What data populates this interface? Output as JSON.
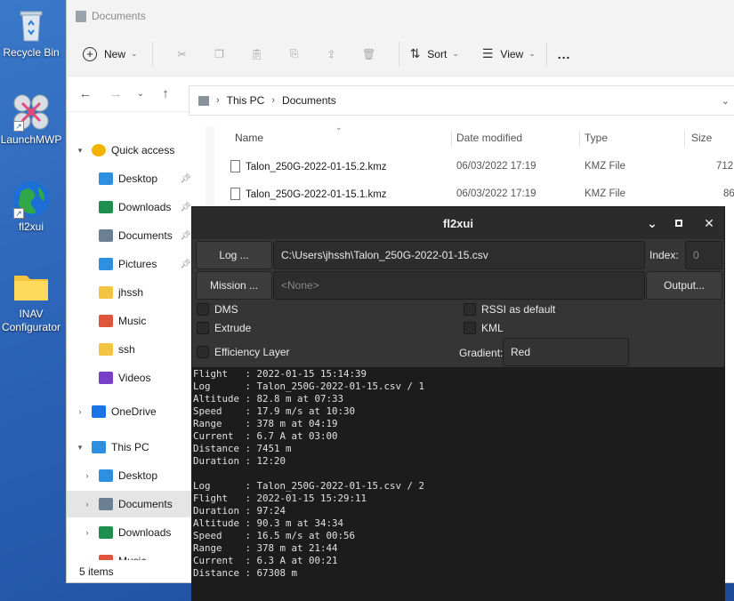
{
  "desktop": {
    "icons": [
      {
        "label": "Recycle Bin"
      },
      {
        "label": "LaunchMWP"
      },
      {
        "label": "fl2xui"
      },
      {
        "label": "INAV\nConfigurator"
      }
    ]
  },
  "explorer": {
    "title": "Documents",
    "toolbar": {
      "new_label": "New",
      "sort_label": "Sort",
      "view_label": "View",
      "more_label": "..."
    },
    "address": {
      "root": "This PC",
      "current": "Documents"
    },
    "sidebar": [
      {
        "label": "Quick access",
        "indent": 0,
        "expander": "▾",
        "icon": "star-icon",
        "pinned": false,
        "selected": false
      },
      {
        "label": "Desktop",
        "indent": 1,
        "expander": "",
        "icon": "desktop-icon",
        "pinned": true,
        "selected": false
      },
      {
        "label": "Downloads",
        "indent": 1,
        "expander": "",
        "icon": "download-icon",
        "pinned": true,
        "selected": false
      },
      {
        "label": "Documents",
        "indent": 1,
        "expander": "",
        "icon": "document-icon",
        "pinned": true,
        "selected": false
      },
      {
        "label": "Pictures",
        "indent": 1,
        "expander": "",
        "icon": "picture-icon",
        "pinned": true,
        "selected": false
      },
      {
        "label": "jhssh",
        "indent": 1,
        "expander": "",
        "icon": "folder-icon",
        "pinned": false,
        "selected": false
      },
      {
        "label": "Music",
        "indent": 1,
        "expander": "",
        "icon": "music-icon",
        "pinned": false,
        "selected": false
      },
      {
        "label": "ssh",
        "indent": 1,
        "expander": "",
        "icon": "folder-icon",
        "pinned": false,
        "selected": false
      },
      {
        "label": "Videos",
        "indent": 1,
        "expander": "",
        "icon": "video-icon",
        "pinned": false,
        "selected": false
      },
      {
        "label": "OneDrive",
        "indent": 0,
        "expander": "›",
        "icon": "cloud-icon",
        "pinned": false,
        "selected": false
      },
      {
        "label": "This PC",
        "indent": 0,
        "expander": "▾",
        "icon": "computer-icon",
        "pinned": false,
        "selected": false
      },
      {
        "label": "Desktop",
        "indent": 1,
        "expander": "›",
        "icon": "desktop-icon",
        "pinned": false,
        "selected": false
      },
      {
        "label": "Documents",
        "indent": 1,
        "expander": "›",
        "icon": "document-icon",
        "pinned": false,
        "selected": true
      },
      {
        "label": "Downloads",
        "indent": 1,
        "expander": "›",
        "icon": "download-icon",
        "pinned": false,
        "selected": false
      },
      {
        "label": "Music",
        "indent": 1,
        "expander": "›",
        "icon": "music-icon",
        "pinned": false,
        "selected": false
      }
    ],
    "columns": {
      "name": "Name",
      "date": "Date modified",
      "type": "Type",
      "size": "Size"
    },
    "files": [
      {
        "name": "Talon_250G-2022-01-15.2.kmz",
        "date": "06/03/2022 17:19",
        "type": "KMZ File",
        "size": "712"
      },
      {
        "name": "Talon_250G-2022-01-15.1.kmz",
        "date": "06/03/2022 17:19",
        "type": "KMZ File",
        "size": "86"
      }
    ],
    "status": "5 items"
  },
  "fl2xui": {
    "title": "fl2xui",
    "log_button": "Log ...",
    "log_path": "C:\\Users\\jhssh\\Talon_250G-2022-01-15.csv",
    "index_label": "Index:",
    "index_value": "0",
    "mission_button": "Mission ...",
    "mission_value": "<None>",
    "output_button": "Output...",
    "options": {
      "dms": "DMS",
      "rssi": "RSSI as default",
      "extrude": "Extrude",
      "kml": "KML",
      "efficiency": "Efficiency Layer"
    },
    "gradient_label": "Gradient:",
    "gradient_value": "Red",
    "console": "Flight   : 2022-01-15 15:14:39\nLog      : Talon_250G-2022-01-15.csv / 1\nAltitude : 82.8 m at 07:33\nSpeed    : 17.9 m/s at 10:30\nRange    : 378 m at 04:19\nCurrent  : 6.7 A at 03:00\nDistance : 7451 m\nDuration : 12:20\n\nLog      : Talon_250G-2022-01-15.csv / 2\nFlight   : 2022-01-15 15:29:11\nDuration : 97:24\nAltitude : 90.3 m at 34:34\nSpeed    : 16.5 m/s at 00:56\nRange    : 378 m at 21:44\nCurrent  : 6.3 A at 00:21\nDistance : 67308 m"
  }
}
